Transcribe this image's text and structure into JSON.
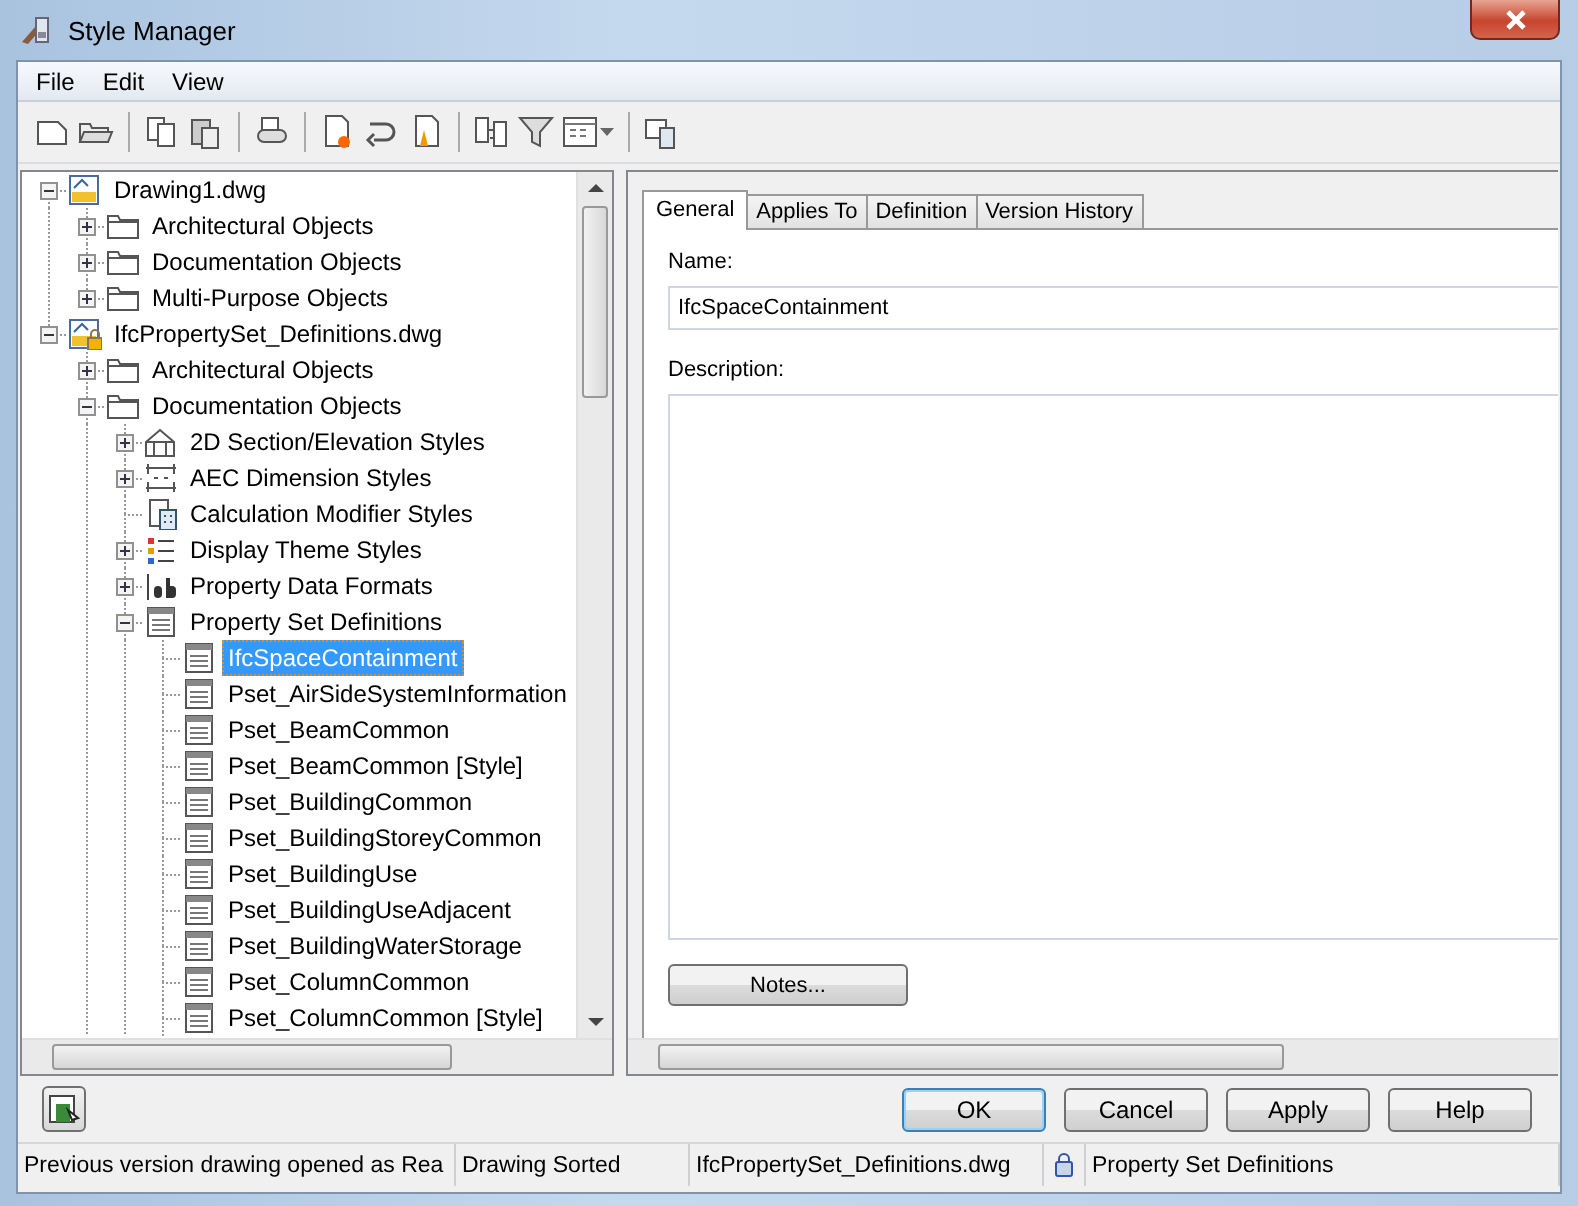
{
  "window": {
    "title": "Style Manager"
  },
  "menu": [
    "File",
    "Edit",
    "View"
  ],
  "tree": {
    "items": [
      {
        "label": "Drawing1.dwg",
        "kind": "drawing",
        "expanded": true,
        "selected": false,
        "children": [
          {
            "label": "Architectural Objects",
            "kind": "folder",
            "expanded": false,
            "selected": false
          },
          {
            "label": "Documentation Objects",
            "kind": "folder",
            "expanded": false,
            "selected": false
          },
          {
            "label": "Multi-Purpose Objects",
            "kind": "folder",
            "expanded": false,
            "selected": false
          }
        ]
      },
      {
        "label": "IfcPropertySet_Definitions.dwg",
        "kind": "drawing-locked",
        "expanded": true,
        "selected": false,
        "children": [
          {
            "label": "Architectural Objects",
            "kind": "folder",
            "expanded": false,
            "selected": false
          },
          {
            "label": "Documentation Objects",
            "kind": "folder",
            "expanded": true,
            "selected": false,
            "more_siblings": true,
            "children": [
              {
                "label": "2D Section/Elevation Styles",
                "kind": "section",
                "expanded": false,
                "selected": false
              },
              {
                "label": "AEC Dimension Styles",
                "kind": "dimension",
                "expanded": false,
                "selected": false
              },
              {
                "label": "Calculation Modifier Styles",
                "kind": "calc",
                "selected": false
              },
              {
                "label": "Display Theme Styles",
                "kind": "theme",
                "expanded": false,
                "selected": false
              },
              {
                "label": "Property Data Formats",
                "kind": "dataformat",
                "expanded": false,
                "selected": false
              },
              {
                "label": "Property Set Definitions",
                "kind": "propset",
                "expanded": true,
                "selected": false,
                "more_siblings": true,
                "children": [
                  {
                    "label": "IfcSpaceContainment",
                    "kind": "propset",
                    "selected": true
                  },
                  {
                    "label": "Pset_AirSideSystemInformation",
                    "kind": "propset",
                    "selected": false
                  },
                  {
                    "label": "Pset_BeamCommon",
                    "kind": "propset",
                    "selected": false
                  },
                  {
                    "label": "Pset_BeamCommon [Style]",
                    "kind": "propset",
                    "selected": false
                  },
                  {
                    "label": "Pset_BuildingCommon",
                    "kind": "propset",
                    "selected": false
                  },
                  {
                    "label": "Pset_BuildingStoreyCommon",
                    "kind": "propset",
                    "selected": false
                  },
                  {
                    "label": "Pset_BuildingUse",
                    "kind": "propset",
                    "selected": false
                  },
                  {
                    "label": "Pset_BuildingUseAdjacent",
                    "kind": "propset",
                    "selected": false
                  },
                  {
                    "label": "Pset_BuildingWaterStorage",
                    "kind": "propset",
                    "selected": false
                  },
                  {
                    "label": "Pset_ColumnCommon",
                    "kind": "propset",
                    "selected": false
                  },
                  {
                    "label": "Pset_ColumnCommon [Style]",
                    "kind": "propset",
                    "selected": false,
                    "more_siblings": true
                  }
                ]
              }
            ]
          }
        ]
      }
    ]
  },
  "tabs": [
    {
      "label": "General",
      "selected": true
    },
    {
      "label": "Applies To",
      "selected": false
    },
    {
      "label": "Definition",
      "selected": false
    },
    {
      "label": "Version History",
      "selected": false
    }
  ],
  "form": {
    "name_label": "Name:",
    "name_value": "IfcSpaceContainment",
    "description_label": "Description:",
    "notes_button": "Notes..."
  },
  "buttons": [
    {
      "label": "OK",
      "default": true
    },
    {
      "label": "Cancel",
      "default": false
    },
    {
      "label": "Apply",
      "default": false
    },
    {
      "label": "Help",
      "default": false
    }
  ],
  "status_bar": [
    "Previous version drawing opened as Rea",
    "Drawing Sorted",
    "IfcPropertySet_Definitions.dwg",
    "Property Set Definitions"
  ]
}
